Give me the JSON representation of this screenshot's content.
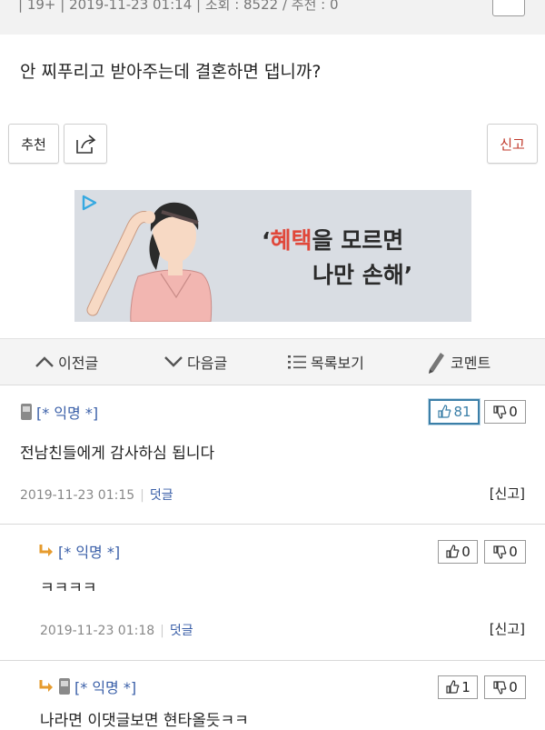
{
  "meta": {
    "text": "| 19+ | 2019-11-23 01:14 | 조회 : 8522 / 추천 : 0"
  },
  "post": {
    "title": "안 찌푸리고 받아주는데 결혼하면 댑니까?"
  },
  "actions": {
    "recommend_label": "추천",
    "report_label": "신고"
  },
  "ad": {
    "line1_accent": "혜택",
    "line1_rest": "을 모르면",
    "line1_open_quote": "‘",
    "line2": "나만 손해’"
  },
  "nav": {
    "prev": "이전글",
    "next": "다음글",
    "list": "목록보기",
    "comment": "코멘트"
  },
  "comments": [
    {
      "author": "[* 익명 *]",
      "text": "전남친들에게 감사하심 됩니다",
      "date": "2019-11-23 01:15",
      "reply": "덧글",
      "report": "[신고]",
      "up": "81",
      "down": "0"
    },
    {
      "author": "[* 익명 *]",
      "text": "ㅋㅋㅋㅋ",
      "date": "2019-11-23 01:18",
      "reply": "덧글",
      "report": "[신고]",
      "up": "0",
      "down": "0"
    },
    {
      "author": "[* 익명 *]",
      "text": "나라면 이댓글보면 현타올듯ㅋㅋ",
      "up": "1",
      "down": "0"
    }
  ],
  "colors": {
    "accent_red": "#e0473a",
    "link_blue": "#3a5fa8",
    "vote_active": "#3b7fa8",
    "report_red": "#c0392b"
  }
}
